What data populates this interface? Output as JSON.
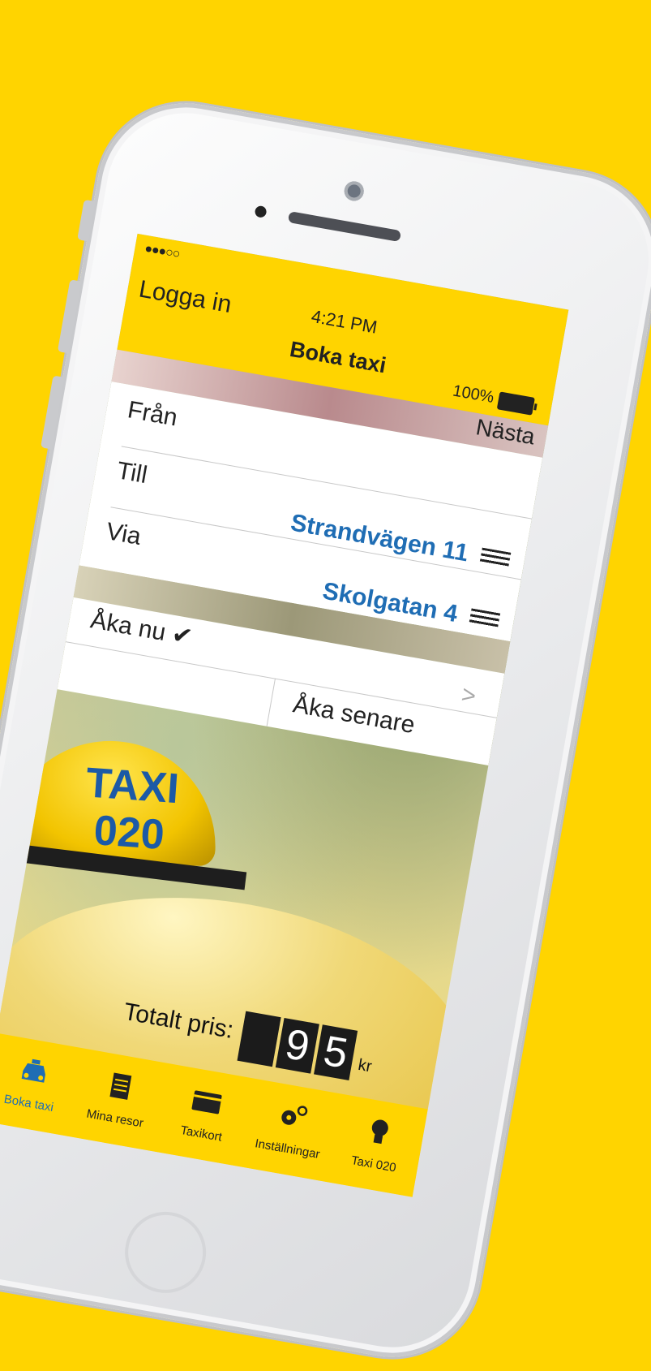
{
  "status_bar": {
    "signal": "●●●○○",
    "time": "4:21 PM",
    "battery": "100%"
  },
  "nav": {
    "left": "Logga in",
    "title": "Boka taxi",
    "right": "Nästa"
  },
  "route": [
    {
      "label": "Från",
      "value": ""
    },
    {
      "label": "Till",
      "value": "Strandvägen 11"
    },
    {
      "label": "Via",
      "value": "Skolgatan 4"
    }
  ],
  "when": {
    "now": "Åka nu",
    "now_check": "✔",
    "later": "Åka senare",
    "chevron": ">"
  },
  "sign": {
    "line1": "TAXI",
    "line2": "020"
  },
  "price": {
    "label": "Totalt pris:",
    "digits": [
      "",
      "9",
      "5"
    ],
    "unit": "kr"
  },
  "tabs": [
    {
      "label": "Boka taxi",
      "icon": "taxi-icon",
      "active": true
    },
    {
      "label": "Mina resor",
      "icon": "notepad-icon"
    },
    {
      "label": "Taxikort",
      "icon": "card-icon"
    },
    {
      "label": "Inställningar",
      "icon": "gears-icon"
    },
    {
      "label": "Taxi 020",
      "icon": "bulb-icon"
    }
  ],
  "colors": {
    "brand_yellow": "#FFD400",
    "accent_blue": "#1f6db4",
    "text_dark": "#222222"
  }
}
